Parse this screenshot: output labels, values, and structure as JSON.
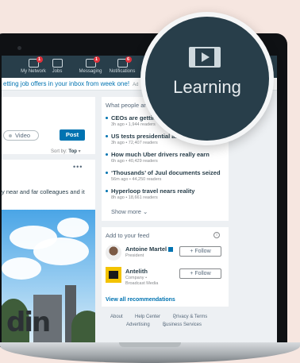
{
  "nav": {
    "items": [
      {
        "label": "My Network",
        "badge": "1"
      },
      {
        "label": "Jobs",
        "badge": ""
      },
      {
        "label": "Messaging",
        "badge": "1"
      },
      {
        "label": "Notifications",
        "badge": "6"
      }
    ]
  },
  "promo": {
    "text": "etting job offers in your inbox from week one!",
    "ad": "Ad"
  },
  "composer": {
    "video_label": "Video",
    "post_label": "Post",
    "sort_label": "Sort by:",
    "sort_value": "Top"
  },
  "post": {
    "menu": "•••",
    "text": "y near and far colleagues and it",
    "sign_text": "din"
  },
  "news": {
    "header": "What people ar",
    "items": [
      {
        "title": "CEOs are getting c",
        "meta": "3h ago • 1,944 readers"
      },
      {
        "title": "US tests presidential alert system",
        "meta": "3h ago • 72,407 readers"
      },
      {
        "title": "How much Uber drivers really earn",
        "meta": "6h ago • 40,429 readers"
      },
      {
        "title": "‘Thousands’ of Juul documents seized",
        "meta": "56m ago • 44,250 readers"
      },
      {
        "title": "Hyperloop travel nears reality",
        "meta": "8h ago • 18,661 readers"
      }
    ],
    "show_more": "Show more"
  },
  "feed": {
    "header": "Add to your feed",
    "info": "i",
    "recs": [
      {
        "name": "Antoine Martel",
        "sub": "President",
        "follow": "+ Follow"
      },
      {
        "name": "Antelith",
        "sub": "Company • Broadcast Media",
        "follow": "+ Follow"
      }
    ],
    "view_all": "View all recommendations"
  },
  "footer": {
    "links": [
      "About",
      "Help Center",
      "Privacy & Terms",
      "Advertising",
      "Business Services"
    ]
  },
  "magnifier": {
    "label": "Learning"
  }
}
